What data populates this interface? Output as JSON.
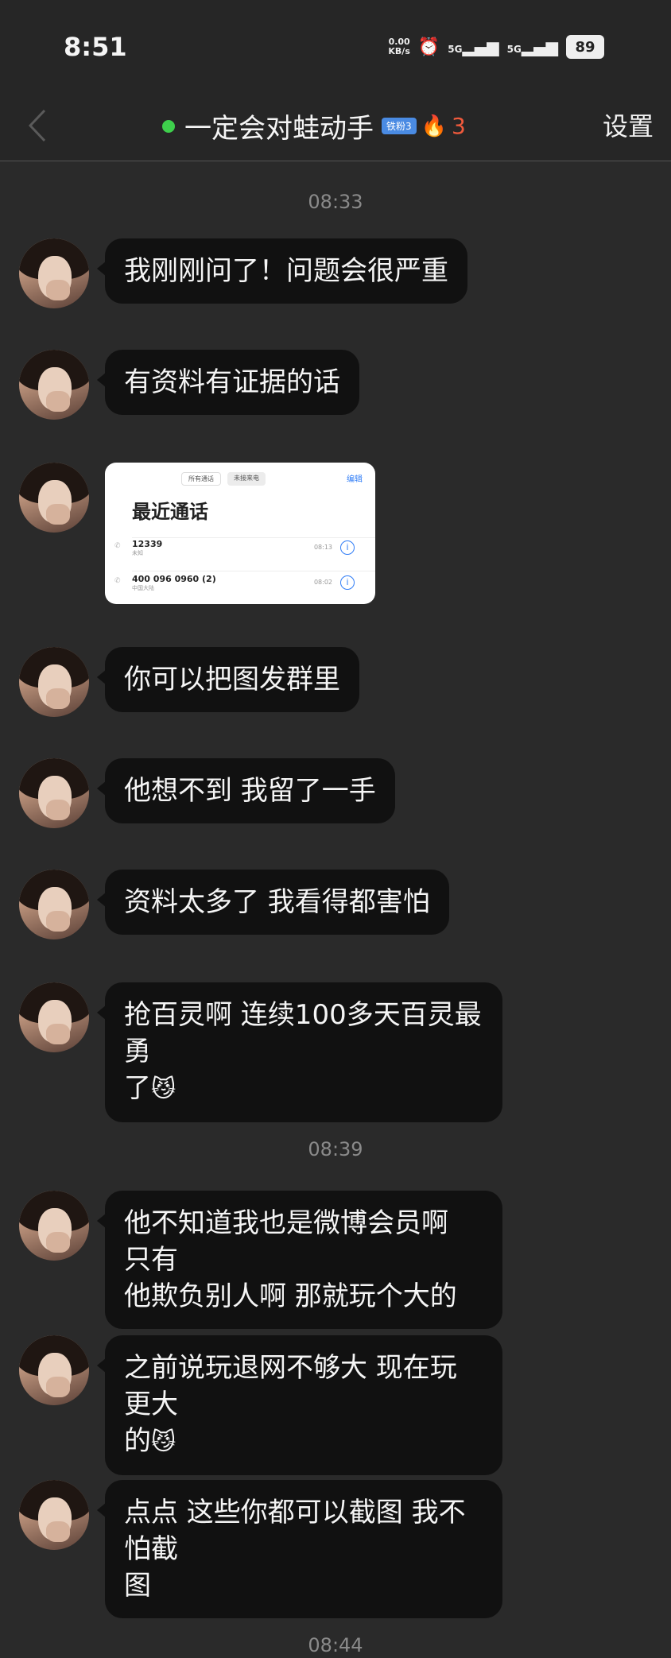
{
  "status_bar": {
    "time": "8:51",
    "net_speed_value": "0.00",
    "net_speed_unit": "KB/s",
    "signal_1": "5G",
    "signal_2": "5G",
    "battery": "89"
  },
  "header": {
    "title": "一定会对蛙动手",
    "badge": "铁粉3",
    "streak": "3",
    "settings_label": "设置"
  },
  "messages": [
    {
      "type": "time",
      "text": "08:33"
    },
    {
      "type": "text",
      "text": "我刚刚问了！问题会很严重"
    },
    {
      "type": "text",
      "text": "有资料有证据的话"
    },
    {
      "type": "image",
      "tab_all": "所有通话",
      "tab_missed": "未接来电",
      "edit": "编辑",
      "title": "最近通话",
      "calls": [
        {
          "number": "12339",
          "sub": "未知",
          "time": "08:13"
        },
        {
          "number": "400 096 0960 (2)",
          "sub": "中国大陆",
          "time": "08:02"
        }
      ]
    },
    {
      "type": "text",
      "text": "你可以把图发群里"
    },
    {
      "type": "text",
      "text": "他想不到 我留了一手"
    },
    {
      "type": "text",
      "text": "资料太多了 我看得都害怕"
    },
    {
      "type": "text",
      "line1": "抢百灵啊 连续100多天百灵最勇",
      "line2": "了",
      "emoji": "😼"
    },
    {
      "type": "time",
      "text": "08:39"
    },
    {
      "type": "text",
      "line1": "他不知道我也是微博会员啊 只有",
      "line2": "他欺负别人啊 那就玩个大的"
    },
    {
      "type": "text",
      "line1": "之前说玩退网不够大 现在玩更大",
      "line2": "的",
      "emoji": "😼"
    },
    {
      "type": "text",
      "line1": "点点 这些你都可以截图 我不怕截",
      "line2": "图"
    },
    {
      "type": "time",
      "text": "08:44"
    }
  ]
}
